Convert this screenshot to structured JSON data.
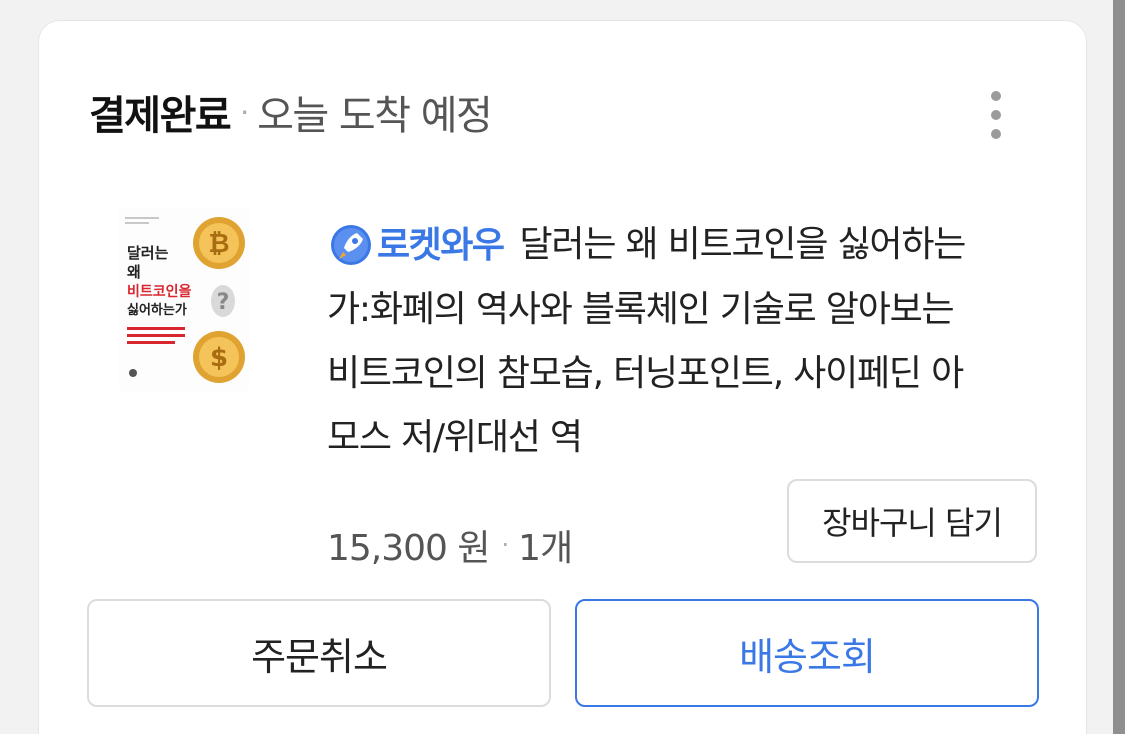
{
  "order": {
    "status": "결제완료",
    "separator": "·",
    "arrival": "오늘 도착 예정",
    "menu_icon": "more-vertical-icon"
  },
  "product": {
    "badge_label": "로켓와우",
    "badge_icon": "rocket-icon",
    "title_lines": [
      "달러는 왜 비트코인을 싫어하는",
      "가:화폐의 역사와 블록체인 기술로 알아보는",
      "비트코인의 참모습, 터닝포인트, 사이페딘 아",
      "모스 저/위대선 역"
    ],
    "price": "15,300 원",
    "quantity": "1개",
    "cover": {
      "line1": "달러는",
      "line2": "왜",
      "line3": "비트코인을",
      "line4": "싫어하는가"
    }
  },
  "actions": {
    "add_to_cart": "장바구니 담기",
    "cancel_order": "주문취소",
    "track_delivery": "배송조회"
  },
  "colors": {
    "accent": "#3a78e6",
    "background": "#f2f2f2",
    "card": "#ffffff",
    "gold": "#d9a23a"
  }
}
